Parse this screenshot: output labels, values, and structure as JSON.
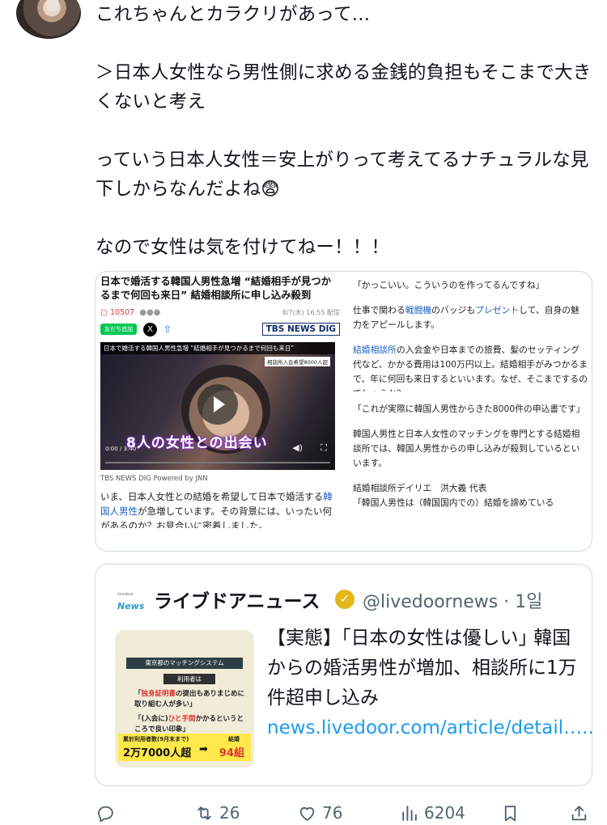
{
  "tweet": {
    "lines": [
      "これちゃんとカラクリがあって…",
      "",
      "＞日本人女性なら男性側に求める金銭的負担もそこまで大きくないと考え",
      "",
      "っていう日本人女性＝安上がりって考えてるナチュラルな見下しからなんだよね😨",
      "",
      "なので女性は気を付けてねー！！！"
    ]
  },
  "article": {
    "title": "日本で婚活する韓国人男性急増 “結婚相手が見つかるまで何回も来日” 結婚相談所に申し込み殺到",
    "comment_count": "10507",
    "date": "8/7(木) 16:55 配信",
    "line_button": "友だち追加",
    "tbs_badge": "TBS NEWS DIG",
    "video_bar": "日本で婚活する韓国人男性急増 “結婚相手が見つかるまで何回も来日”",
    "video_sub": "相談所入会希望8000人超",
    "video_caption": "8人の女性との出会い",
    "video_time": "0:00 / 3:40",
    "powered": "TBS NEWS DIG Powered by JNN",
    "body_pre": "いま、日本人女性との結婚を希望して日本で婚活する",
    "body_link": "韓国人男性",
    "body_post": "が急増しています。その背景には、いったい何があるのか？お見合いに密着しました。",
    "right_p1": "「かっこいい。こういうのを作ってるんですね」",
    "right_p2_pre": "仕事で関わる",
    "right_p2_link1": "戦闘機",
    "right_p2_mid": "のバッジも",
    "right_p2_link2": "プレゼント",
    "right_p2_post": "して、自身の魅力をアピールします。",
    "right_p3_link": "結婚相談所",
    "right_p3_post": "の入会金や日本までの旅費、髪のセッティング代など、かかる費用は100万円以上。結婚相手がみつかるまで、年に何回も来日するといいます。なぜ、そこまでするのでしょうか？",
    "right_p4": "「これが実際に韓国人男性からきた8000件の申込書です」",
    "right_p5": "韓国人男性と日本人女性のマッチングを専門とする結婚相談所では、韓国人男性からの申し込みが殺到しているといいます。",
    "right_p6": "結婚相談所デイリエ　洪大義 代表",
    "right_p7": "「韓国人男性は（韓国国内での）結婚を諦めている"
  },
  "quote": {
    "logo_small": "livedoor",
    "logo_news": "News",
    "name": "ライブドアニュース",
    "handle": "@livedoornews · 1일",
    "text": "【実態】｢日本の女性は優しい｣ 韓国からの婚活男性が増加、相談所に1万件超申し込み",
    "link": "news.livedoor.com/article/detail…..",
    "thumb_header": "東京都のマッチングシステム",
    "thumb_users": "利用者は",
    "thumb_l1_pre": "「",
    "thumb_l1_red": "独身証明書",
    "thumb_l1_post": "の提出もありまじめに取り組む人が多い」",
    "thumb_l2_pre": "「(入会に)",
    "thumb_l2_red": "ひと手間",
    "thumb_l2_post": "かかるというところで良い印象」",
    "thumb_stat_label": "累計利用者数(9月末まで)",
    "thumb_stat_label2": "結婚",
    "thumb_stat_value": "2万7000人超",
    "thumb_stat_value2": "94組"
  },
  "actions": {
    "retweets": "26",
    "likes": "76",
    "views": "6204"
  },
  "icons": {
    "reply": "reply-icon",
    "retweet": "retweet-icon",
    "like": "heart-icon",
    "views": "views-icon",
    "bookmark": "bookmark-icon",
    "share": "share-icon",
    "verified": "verified-badge-icon"
  }
}
